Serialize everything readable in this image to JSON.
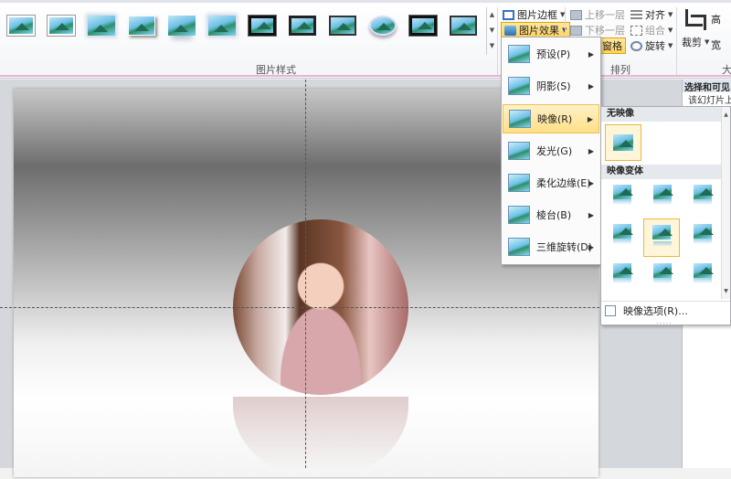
{
  "ribbon": {
    "group_label_styles": "图片样式",
    "group_label_arrange": "排列",
    "group_label_size": "大",
    "picture_border": "图片边框",
    "picture_effects": "图片效果",
    "bring_forward": "上移一层",
    "send_backward": "下移一层",
    "align": "对齐",
    "group": "组合",
    "rotate": "旋转",
    "selection_pane": "窗格",
    "crop": "裁剪",
    "height_short": "高",
    "width_short": "宽"
  },
  "styles_gallery": [
    {
      "icon": "simple-frame-icon"
    },
    {
      "icon": "white-frame-icon"
    },
    {
      "icon": "soft-frame-icon"
    },
    {
      "icon": "shadow-frame-icon"
    },
    {
      "icon": "reflected-frame-icon"
    },
    {
      "icon": "soft-edge-icon"
    },
    {
      "icon": "thick-black-frame-icon"
    },
    {
      "icon": "black-frame-icon"
    },
    {
      "icon": "thin-frame-icon"
    },
    {
      "icon": "oval-frame-icon"
    },
    {
      "icon": "double-frame-icon"
    },
    {
      "icon": "dark-frame-icon"
    }
  ],
  "effects_menu": {
    "items": [
      {
        "label": "预设(P)",
        "icon": "preset-icon"
      },
      {
        "label": "阴影(S)",
        "icon": "shadow-icon"
      },
      {
        "label": "映像(R)",
        "icon": "reflection-icon",
        "active": true
      },
      {
        "label": "发光(G)",
        "icon": "glow-icon"
      },
      {
        "label": "柔化边缘(E)",
        "icon": "soft-edges-icon"
      },
      {
        "label": "棱台(B)",
        "icon": "bevel-icon"
      },
      {
        "label": "三维旋转(D)",
        "icon": "3d-rotation-icon"
      }
    ]
  },
  "reflection_menu": {
    "no_reflection": "无映像",
    "variations": "映像变体",
    "options": "映像选项(R)...",
    "grip": "....."
  },
  "selection_pane": {
    "title": "选择和可见",
    "subtitle": "该幻灯片上"
  },
  "colors": {
    "accent_border": "#e0a500",
    "highlight": "#ffd35c",
    "ribbon_rule": "#e7b6d2"
  }
}
